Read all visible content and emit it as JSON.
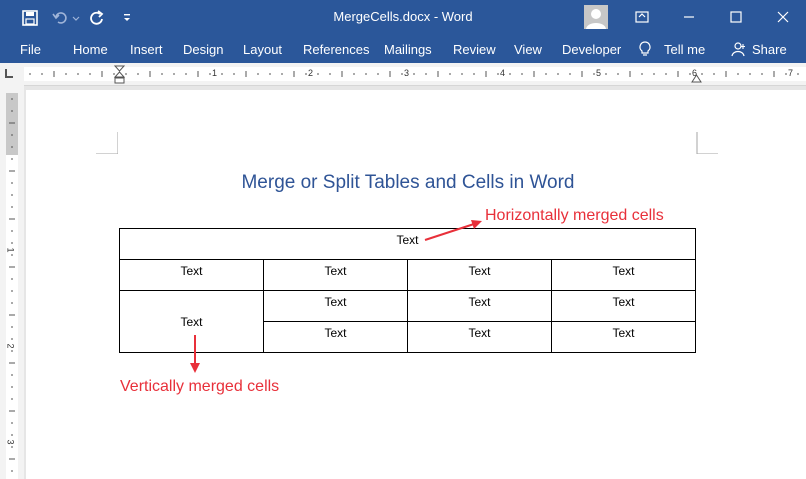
{
  "window": {
    "title": "MergeCells.docx  -  Word"
  },
  "menu": {
    "file": "File",
    "home": "Home",
    "insert": "Insert",
    "design": "Design",
    "layout": "Layout",
    "references": "References",
    "mailings": "Mailings",
    "review": "Review",
    "view": "View",
    "developer": "Developer",
    "tell_me": "Tell me",
    "share": "Share"
  },
  "ruler": {
    "horizontal": [
      "1",
      "2",
      "3",
      "4",
      "5",
      "6",
      "7"
    ],
    "vertical": [
      "1",
      "2",
      "3"
    ]
  },
  "document": {
    "title": "Merge or Split Tables and Cells in Word",
    "table": {
      "row1": "Text",
      "row2": [
        "Text",
        "Text",
        "Text",
        "Text"
      ],
      "merged": "Text",
      "row3": [
        "Text",
        "Text",
        "Text"
      ],
      "row4": [
        "Text",
        "Text",
        "Text"
      ]
    }
  },
  "annotations": {
    "horizontal": "Horizontally merged cells",
    "vertical": "Vertically merged cells"
  },
  "colors": {
    "brand": "#2b579a",
    "title": "#2f5496",
    "annotation": "#e8303a"
  }
}
